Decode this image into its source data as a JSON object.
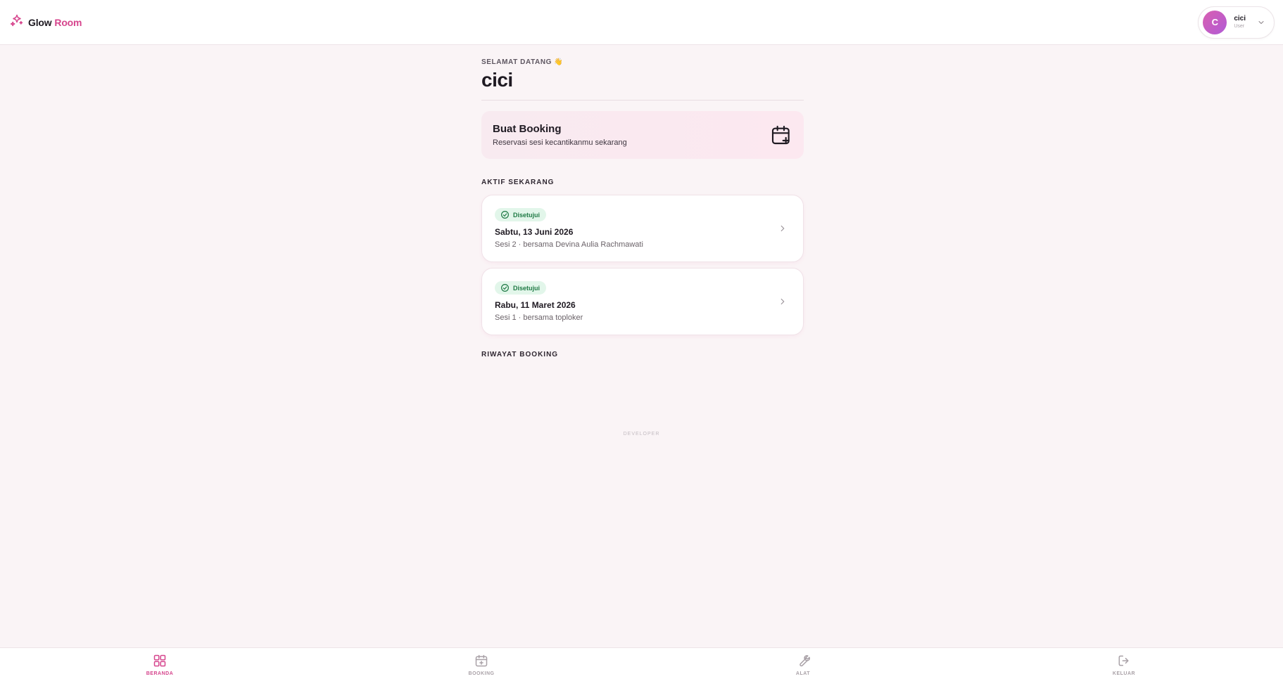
{
  "brand": {
    "name_part1": "Glow",
    "name_part2": "Room",
    "icon": "sparkles-icon"
  },
  "user": {
    "initial": "C",
    "name": "cici",
    "role": "User"
  },
  "welcome": {
    "label": "SELAMAT DATANG 👋",
    "name": "cici"
  },
  "booking_cta": {
    "title": "Buat Booking",
    "subtitle": "Reservasi sesi kecantikanmu sekarang",
    "icon": "calendar-plus-icon"
  },
  "sections": {
    "active": "AKTIF SEKARANG",
    "history": "RIWAYAT BOOKING"
  },
  "active_bookings": [
    {
      "status": "Disetujui",
      "date": "Sabtu, 13 Juni 2026",
      "detail": "Sesi 2 · bersama Devina Aulia Rachmawati"
    },
    {
      "status": "Disetujui",
      "date": "Rabu, 11 Maret 2026",
      "detail": "Sesi 1 · bersama toploker"
    }
  ],
  "footer": {
    "developer": "DEVELOPER"
  },
  "bottom_nav": [
    {
      "label": "BERANDA",
      "icon": "dashboard-grid-icon",
      "active": true
    },
    {
      "label": "BOOKING",
      "icon": "calendar-plus-icon",
      "active": false
    },
    {
      "label": "ALAT",
      "icon": "wrench-icon",
      "active": false
    },
    {
      "label": "KELUAR",
      "icon": "logout-icon",
      "active": false
    }
  ],
  "colors": {
    "accent": "#d6458d",
    "background": "#faf4f6",
    "approved_bg": "#e2f6ea",
    "approved_text": "#1f7a45"
  }
}
